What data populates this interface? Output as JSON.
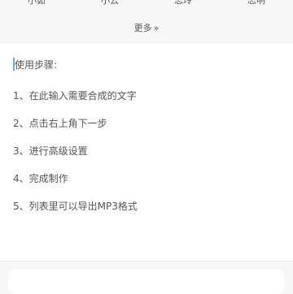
{
  "voices": [
    "小茹",
    "小云",
    "志玲",
    "志明"
  ],
  "more": {
    "label": "更多",
    "chevron": "»"
  },
  "editor": {
    "heading": "使用步骤:",
    "steps": [
      "1、在此输入需要合成的文字",
      "2、点击右上角下一步",
      "3、进行高级设置",
      "4、完成制作",
      "5、列表里可以导出MP3格式"
    ]
  }
}
